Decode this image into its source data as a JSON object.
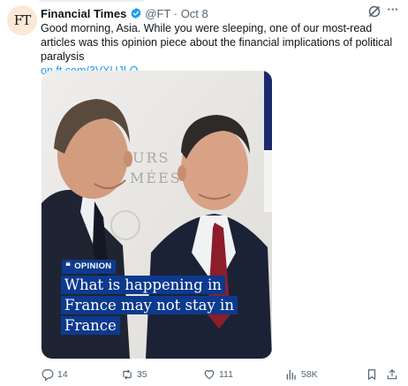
{
  "tweet": {
    "avatar_text": "FT",
    "author_name": "Financial Times",
    "handle_date": "@FT · Oct 8",
    "body": "Good morning, Asia. While you were sleeping, one of our most-read articles was this opinion piece about the financial implications of political paralysis",
    "link": "on.ft.com/3VXUJLQ"
  },
  "media": {
    "badge": "OPINION",
    "headline": "What is happening in France may not stay in France",
    "background_text_1": "URS",
    "background_text_2": "MÉES"
  },
  "actions": {
    "replies": "14",
    "reposts": "35",
    "likes": "111",
    "views": "58K"
  },
  "colors": {
    "link": "#1d9bf0",
    "verified": "#1d9bf0",
    "ft_blue": "#0d3a8e",
    "avatar_bg": "#fce8d5",
    "muted": "#536471"
  },
  "icons": [
    "verified-badge-icon",
    "grok-icon",
    "more-icon",
    "reply-icon",
    "repost-icon",
    "like-icon",
    "views-icon",
    "bookmark-icon",
    "share-icon"
  ]
}
